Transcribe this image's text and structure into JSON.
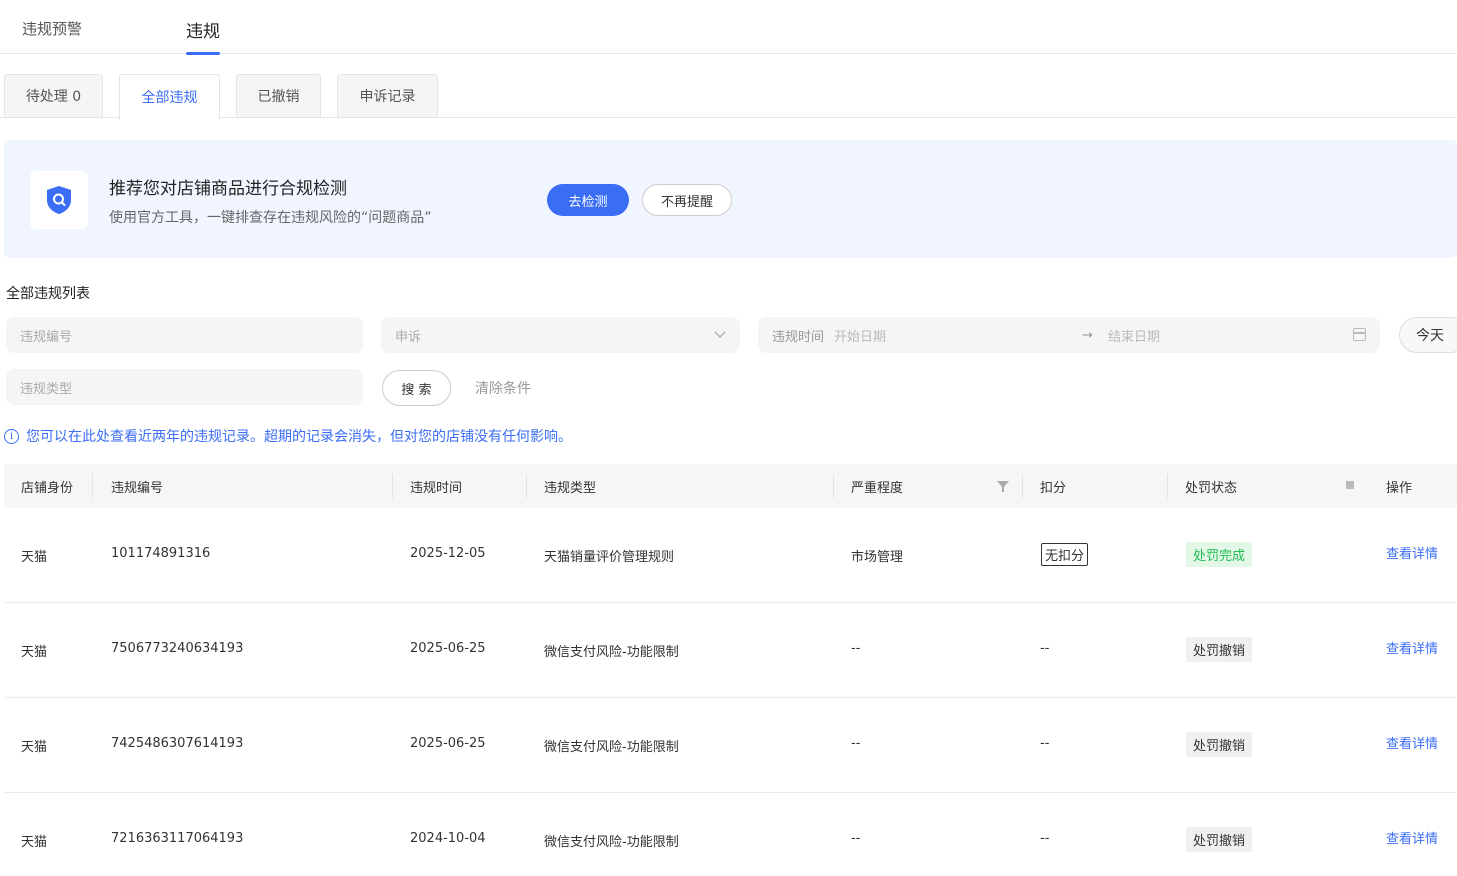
{
  "top_tabs": [
    "违规预警",
    "违规"
  ],
  "sub_tabs": [
    "待处理 0",
    "全部违规",
    "已撤销",
    "申诉记录"
  ],
  "banner": {
    "title": "推荐您对店铺商品进行合规检测",
    "subtitle": "使用官方工具，一键排查存在违规风险的“问题商品”",
    "primary_button": "去检测",
    "secondary_button": "不再提醒",
    "icon": "shield-search-icon",
    "accent": "#3b6ef5"
  },
  "filters": {
    "section_title": "全部违规列表",
    "violation_id_placeholder": "违规编号",
    "appeal_placeholder": "申诉",
    "date_label": "违规时间",
    "date_start_placeholder": "开始日期",
    "date_end_placeholder": "结束日期",
    "today_button": "今天",
    "violation_type_placeholder": "违规类型",
    "search_button": "搜 索",
    "clear_button": "清除条件"
  },
  "notice": "您可以在此处查看近两年的违规记录。超期的记录会消失，但对您的店铺没有任何影响。",
  "table": {
    "columns": [
      "店铺身份",
      "违规编号",
      "违规时间",
      "违规类型",
      "严重程度",
      "扣分",
      "处罚状态",
      "操作"
    ],
    "rows": [
      {
        "shop": "天猫",
        "id": "101174891316",
        "date": "2025-12-05",
        "type": "天猫销量评价管理规则",
        "severity": "市场管理",
        "points": "无扣分",
        "status": "处罚完成",
        "action": "查看详情"
      },
      {
        "shop": "天猫",
        "id": "7506773240634193",
        "date": "2025-06-25",
        "type": "微信支付风险-功能限制",
        "severity": "--",
        "points": "--",
        "status": "处罚撤销",
        "action": "查看详情"
      },
      {
        "shop": "天猫",
        "id": "7425486307614193",
        "date": "2025-06-25",
        "type": "微信支付风险-功能限制",
        "severity": "--",
        "points": "--",
        "status": "处罚撤销",
        "action": "查看详情"
      },
      {
        "shop": "天猫",
        "id": "7216363117064193",
        "date": "2024-10-04",
        "type": "微信支付风险-功能限制",
        "severity": "--",
        "points": "--",
        "status": "处罚撤销",
        "action": "查看详情"
      }
    ]
  }
}
